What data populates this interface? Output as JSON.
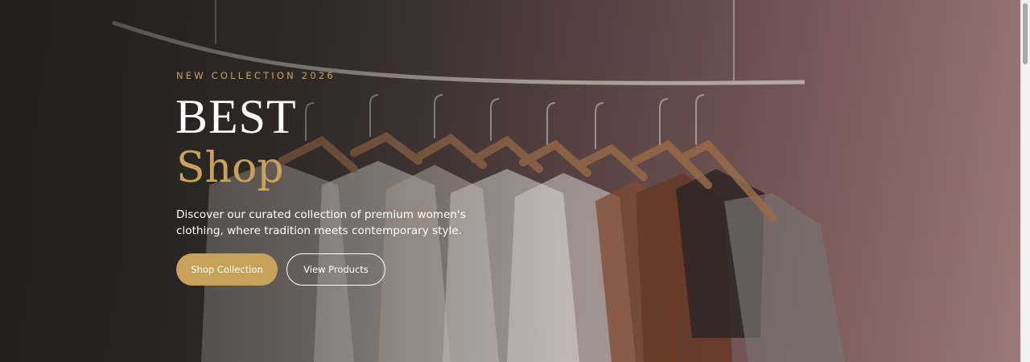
{
  "hero": {
    "eyebrow": "NEW COLLECTION 2026",
    "title_line1": "BEST",
    "title_line2": "Shop",
    "description": "Discover our curated collection of premium women's clothing, where tradition meets contemporary style.",
    "background_image": "clothing-rack-with-hangers",
    "accent_color": "#c9a25a"
  },
  "buttons": {
    "primary_label": "Shop Collection",
    "secondary_label": "View Products"
  }
}
